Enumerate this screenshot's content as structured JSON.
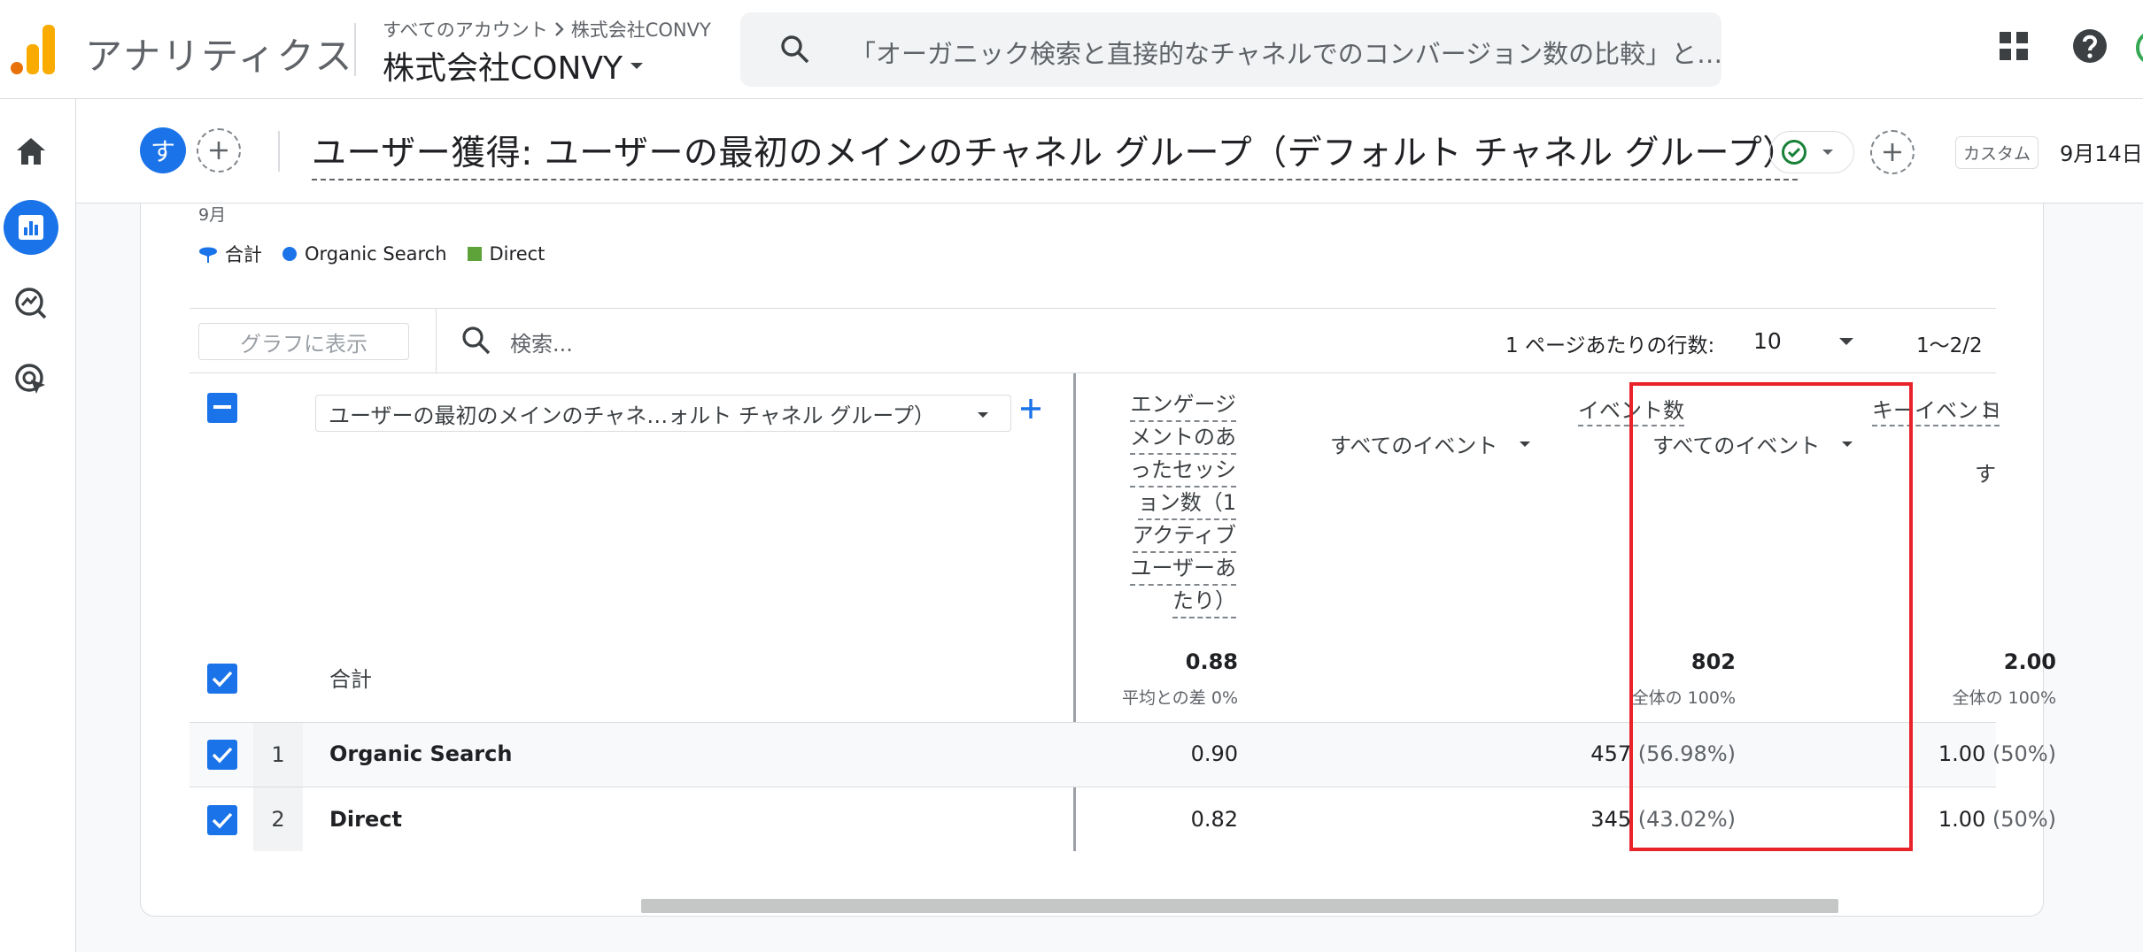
{
  "app": {
    "name": "アナリティクス"
  },
  "account": {
    "crumb_root": "すべてのアカウント",
    "crumb_leaf": "株式会社CONVY",
    "property": "株式会社CONVY"
  },
  "search": {
    "placeholder": "「オーガニック検索と直接的なチャネルでのコンバージョン数の比較」と…"
  },
  "report": {
    "avatar_letter": "す",
    "title": "ユーザー獲得: ユーザーの最初のメインのチャネル グループ（デフォルト チャネル グループ）",
    "custom_label": "カスタム",
    "date": "9月14日"
  },
  "chart": {
    "month": "9月",
    "legend": [
      {
        "label": "合計",
        "color": "#1a73e8"
      },
      {
        "label": "Organic Search",
        "color": "#1a73e8"
      },
      {
        "label": "Direct",
        "color": "#5ea33a"
      }
    ]
  },
  "toolbar": {
    "graph_button": "グラフに表示",
    "search_placeholder": "検索...",
    "rows_label": "1 ページあたりの行数:",
    "rows_value": "10",
    "pager": "1〜2/2"
  },
  "table": {
    "dimension_select": "ユーザーの最初のメインのチャネ…ォルト チャネル グループ）",
    "columns": {
      "engaged": [
        "エンゲージ",
        "メントのあ",
        "ったセッシ",
        "ョン数（1",
        "アクティブ",
        "ユーザーあ",
        "たり）"
      ],
      "events": {
        "title": "イベント数",
        "sub": "すべてのイベント"
      },
      "key_events": {
        "title": "キーイベント",
        "sub": "すべてのイベント"
      },
      "next_partial": {
        "title": "コ",
        "sub": "す"
      }
    },
    "totals": {
      "label": "合計",
      "engaged": "0.88",
      "engaged_sub": "平均との差 0%",
      "events": "802",
      "events_sub": "全体の 100%",
      "key_events": "2.00",
      "key_events_sub": "全体の 100%"
    },
    "rows": [
      {
        "index": "1",
        "name": "Organic Search",
        "engaged": "0.90",
        "events": "457",
        "events_pct": "(56.98%)",
        "key_events": "1.00",
        "key_events_pct": "(50%)"
      },
      {
        "index": "2",
        "name": "Direct",
        "engaged": "0.82",
        "events": "345",
        "events_pct": "(43.02%)",
        "key_events": "1.00",
        "key_events_pct": "(50%)"
      }
    ]
  },
  "colors": {
    "accent": "#1a73e8",
    "highlight": "#e8232a",
    "legend_direct": "#5ea33a"
  }
}
